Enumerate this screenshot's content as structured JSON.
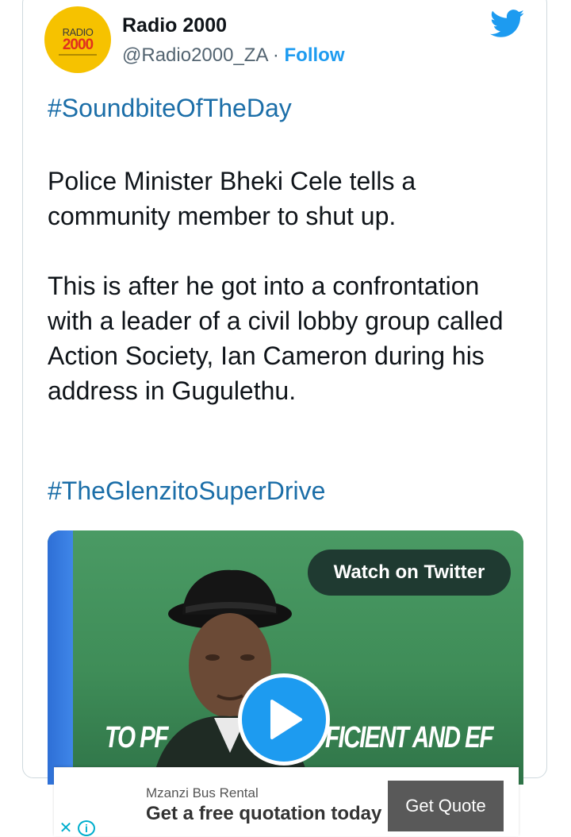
{
  "tweet": {
    "author": {
      "name": "Radio 2000",
      "handle": "@Radio2000_ZA",
      "separator": "·",
      "follow_label": "Follow",
      "avatar_text_top": "RADIO",
      "avatar_text_main": "2000",
      "avatar_icon": "radio-2000-logo"
    },
    "platform_icon": "twitter-bird-icon",
    "hashtag_top": "#SoundbiteOfTheDay",
    "paragraph_1": "Police Minister Bheki Cele tells a community member to shut up.",
    "paragraph_2": "This is after he got into a confrontation with a leader of a civil lobby group called Action Society, Ian Cameron during his address in Gugulethu.",
    "hashtag_bottom": "#TheGlenzitoSuperDrive",
    "media": {
      "watch_label": "Watch on Twitter",
      "banner_left": "TO PF",
      "banner_right": "FICIENT AND EF",
      "play_icon": "play-icon"
    }
  },
  "ad": {
    "brand": "Mzanzi Bus Rental",
    "text": "Get a free quotation today",
    "cta": "Get Quote",
    "close_icon": "close-icon",
    "info_icon": "info-icon"
  },
  "colors": {
    "link_blue": "#1d9bf0",
    "hashtag_blue": "#1b6ea8",
    "text": "#0f1419",
    "muted": "#536471",
    "video_green": "#3d8b5a",
    "ad_button": "#595959"
  }
}
